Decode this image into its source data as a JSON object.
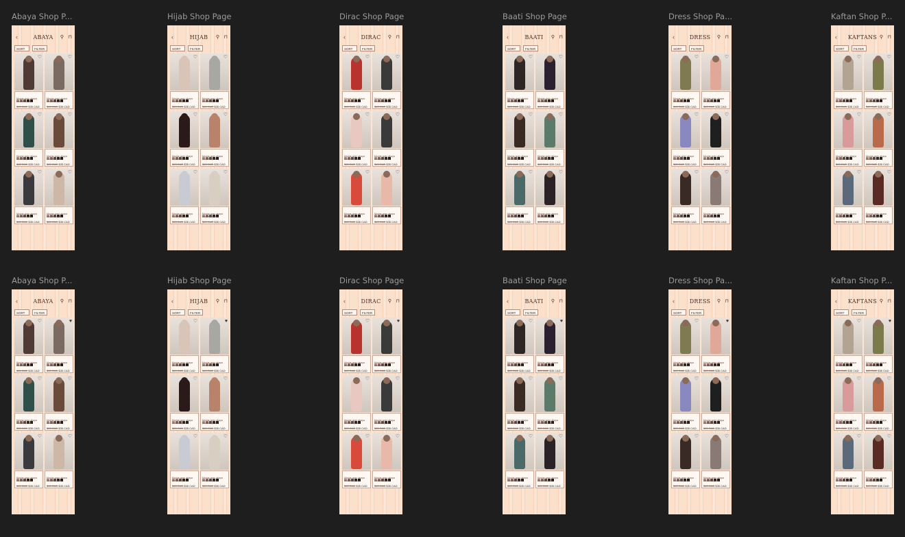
{
  "frames": [
    {
      "label": "Abaya Shop P...",
      "title": "ABAYA",
      "theme": "abaya",
      "hero": "#4f3a35"
    },
    {
      "label": "Hijab Shop Page",
      "title": "HIJAB",
      "theme": "hijab",
      "hero": "#d9c4b8"
    },
    {
      "label": "Dirac Shop Page",
      "title": "DIRAC",
      "theme": "dirac",
      "hero": "#b8332e"
    },
    {
      "label": "Baati Shop Page",
      "title": "BAATI",
      "theme": "baati",
      "hero": "#2e2624"
    },
    {
      "label": "Dress Shop Pa...",
      "title": "DRESS",
      "theme": "dress",
      "hero": "#7f7a52"
    },
    {
      "label": "Kaftan Shop P...",
      "title": "KAFTANS",
      "theme": "kaftan",
      "hero": "#b3a393"
    },
    {
      "label": "Abaya Shop P...",
      "title": "ABAYA",
      "theme": "abaya",
      "hero": "#4f3a35"
    },
    {
      "label": "Hijab Shop Page",
      "title": "HIJAB",
      "theme": "hijab",
      "hero": "#d9c4b8"
    },
    {
      "label": "Dirac Shop Page",
      "title": "DIRAC",
      "theme": "dirac",
      "hero": "#b8332e"
    },
    {
      "label": "Baati Shop Page",
      "title": "BAATI",
      "theme": "baati",
      "hero": "#2e2624"
    },
    {
      "label": "Dress Shop Pa...",
      "title": "DRESS",
      "theme": "dress",
      "hero": "#7f7a52"
    },
    {
      "label": "Kaftan Shop P...",
      "title": "KAFTANS",
      "theme": "kaftan",
      "hero": "#b3a393"
    }
  ],
  "controls": {
    "sort": "SORT ⇅",
    "filter": "FILTER ⛉"
  },
  "product": {
    "name": "Mocha open abaya double layered",
    "old_price": "$45 CAD",
    "price": "$35 CAD"
  },
  "icons": {
    "back": "chevron-left-icon",
    "search": "search-icon",
    "bag": "shopping-bag-icon",
    "heart": "heart-icon"
  },
  "palettes": {
    "abaya": [
      "#4f3a35",
      "#7a6a62",
      "#2f4f4a",
      "#6a4a3a",
      "#3a3a3e",
      "#cdb8a8"
    ],
    "hijab": [
      "#d9c4b8",
      "#a8a8a2",
      "#2a1a1a",
      "#b8836a",
      "#c8ccd2",
      "#d8cfc2"
    ],
    "dirac": [
      "#b8332e",
      "#3a3a38",
      "#e8c8c0",
      "#3a3a3a",
      "#d84a3a",
      "#e8b8a8"
    ],
    "baati": [
      "#2e2624",
      "#2a2030",
      "#3a2a24",
      "#5a7a6a",
      "#4a6a6a",
      "#2a2224"
    ],
    "dress": [
      "#7f7a52",
      "#e0a898",
      "#8a88c0",
      "#1e2020",
      "#3a2a26",
      "#8a7a76"
    ],
    "kaftan": [
      "#b3a393",
      "#7a7a4a",
      "#d89a9a",
      "#b86a4a",
      "#5a6a7a",
      "#5a2a24"
    ]
  },
  "swatch_colors": [
    "#b08a80",
    "#8a6a64",
    "#5a4a44",
    "#2a2020",
    "#1a1414"
  ]
}
